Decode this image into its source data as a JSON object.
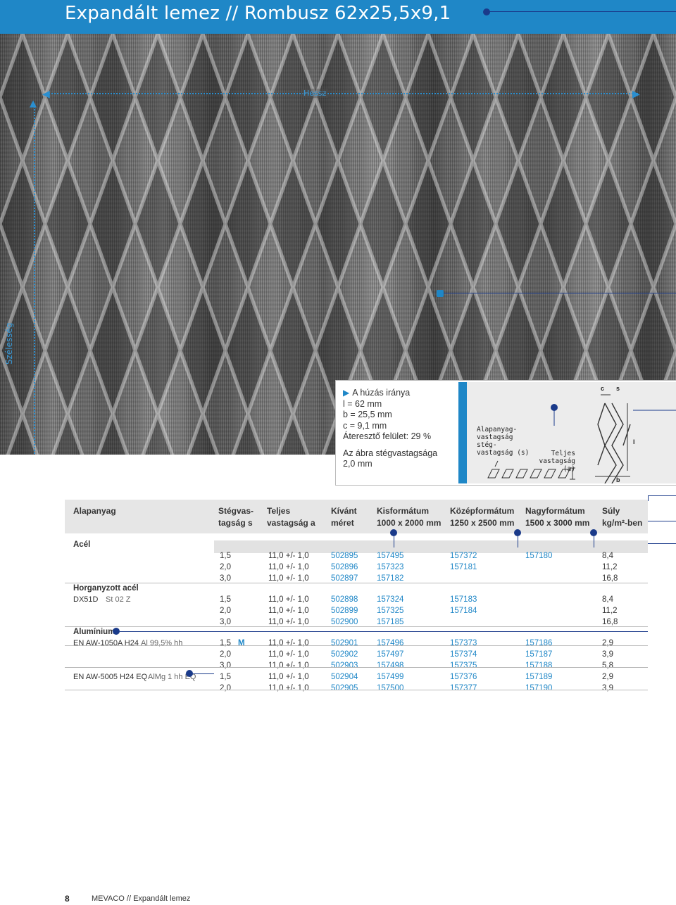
{
  "title": "Expandált lemez // Rombusz 62x25,5x9,1",
  "photo": {
    "length_label": "Hossz",
    "width_label": "Szélesség"
  },
  "info": {
    "direction": "A húzás iránya",
    "l": "l = 62 mm",
    "b": "b = 25,5 mm",
    "c": "c = 9,1 mm",
    "open_area": "Áteresztő felület: 29 %",
    "note_line1": "Az ábra stégvastagsága",
    "note_line2": "2,0 mm"
  },
  "diagram": {
    "base_thickness_1": "Alapanyag-",
    "base_thickness_2": "vastagság",
    "strand_1": "stég-",
    "strand_2": "vastagság (s)",
    "total_1": "Teljes",
    "total_2": "vastagság (a)",
    "c": "c",
    "s": "s",
    "l": "l",
    "b": "b"
  },
  "table": {
    "headers": {
      "material": "Alapanyag",
      "strand_1": "Stégvas-",
      "strand_2": "tagság s",
      "total_1": "Teljes",
      "total_2": "vastagság a",
      "custom_1": "Kívánt",
      "custom_2": "méret",
      "small_1": "Kisformátum",
      "small_2": "1000 x 2000 mm",
      "medium_1": "Középformátum",
      "medium_2": "1250 x 2500 mm",
      "large_1": "Nagyformátum",
      "large_2": "1500 x 3000 mm",
      "weight_1": "Súly",
      "weight_2": "kg/m²-ben"
    },
    "groups": {
      "steel": "Acél",
      "galv": "Horganyzott acél",
      "alu": "Alumínium"
    },
    "rows": [
      {
        "mat": "",
        "mat2": "",
        "s": "1,5",
        "m": "",
        "a": "11,0 +/- 1,0",
        "custom": "502895",
        "small": "157495",
        "medium": "157372",
        "large": "157180",
        "w": "8,4"
      },
      {
        "mat": "",
        "mat2": "",
        "s": "2,0",
        "m": "",
        "a": "11,0 +/- 1,0",
        "custom": "502896",
        "small": "157323",
        "medium": "157181",
        "large": "",
        "w": "11,2"
      },
      {
        "mat": "",
        "mat2": "",
        "s": "3,0",
        "m": "",
        "a": "11,0 +/- 1,0",
        "custom": "502897",
        "small": "157182",
        "medium": "",
        "large": "",
        "w": "16,8"
      },
      {
        "mat": "DX51D",
        "mat2": "St 02 Z",
        "s": "1,5",
        "m": "",
        "a": "11,0 +/- 1,0",
        "custom": "502898",
        "small": "157324",
        "medium": "157183",
        "large": "",
        "w": "8,4"
      },
      {
        "mat": "",
        "mat2": "",
        "s": "2,0",
        "m": "",
        "a": "11,0 +/- 1,0",
        "custom": "502899",
        "small": "157325",
        "medium": "157184",
        "large": "",
        "w": "11,2"
      },
      {
        "mat": "",
        "mat2": "",
        "s": "3,0",
        "m": "",
        "a": "11,0 +/- 1,0",
        "custom": "502900",
        "small": "157185",
        "medium": "",
        "large": "",
        "w": "16,8"
      },
      {
        "mat": "EN AW-1050A H24",
        "mat2": "Al 99,5% hh",
        "s": "1,5",
        "m": "M",
        "a": "11,0 +/- 1,0",
        "custom": "502901",
        "small": "157496",
        "medium": "157373",
        "large": "157186",
        "w": "2,9"
      },
      {
        "mat": "",
        "mat2": "",
        "s": "2,0",
        "m": "",
        "a": "11,0 +/- 1,0",
        "custom": "502902",
        "small": "157497",
        "medium": "157374",
        "large": "157187",
        "w": "3,9"
      },
      {
        "mat": "",
        "mat2": "",
        "s": "3,0",
        "m": "",
        "a": "11,0 +/- 1,0",
        "custom": "502903",
        "small": "157498",
        "medium": "157375",
        "large": "157188",
        "w": "5,8"
      },
      {
        "mat": "EN AW-5005 H24 EQ",
        "mat2": "AlMg 1 hh EQ",
        "s": "1,5",
        "m": "",
        "a": "11,0 +/- 1,0",
        "custom": "502904",
        "small": "157499",
        "medium": "157376",
        "large": "157189",
        "w": "2,9"
      },
      {
        "mat": "",
        "mat2": "",
        "s": "2,0",
        "m": "",
        "a": "11,0 +/- 1,0",
        "custom": "502905",
        "small": "157500",
        "medium": "157377",
        "large": "157190",
        "w": "3,9"
      }
    ]
  },
  "footer": {
    "page": "8",
    "text": "MEVACO // Expandált lemez"
  },
  "colors": {
    "accent": "#1f87c7",
    "dark_marker": "#1a3a8a"
  }
}
